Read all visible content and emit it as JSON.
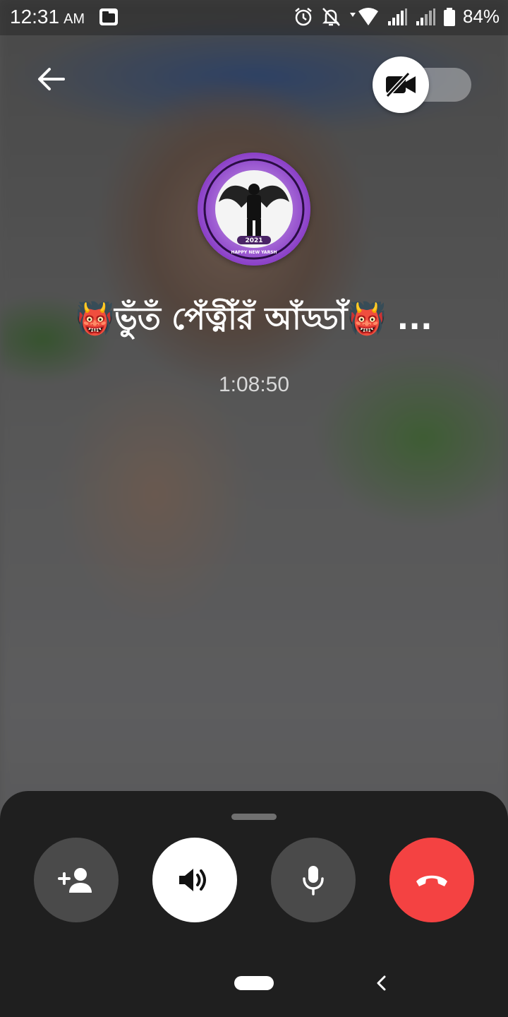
{
  "status_bar": {
    "time": "12:31",
    "ampm": "AM",
    "battery_percent": "84%",
    "icons": [
      "folder-icon",
      "alarm-icon",
      "notifications-off-icon",
      "wifi-icon",
      "signal-icon",
      "signal-icon-2",
      "battery-icon"
    ]
  },
  "call": {
    "name": "👹ভুঁতঁ পেঁত্নীঁরঁ আঁড্ডাঁ👹 ...",
    "duration": "1:08:50"
  },
  "avatar": {
    "badge_text": "2021",
    "footer_text": "HAPPY NEW YARSH"
  },
  "controls": {
    "add_person": "add-person-icon",
    "speaker": "speaker-icon",
    "mic": "mic-icon",
    "end_call": "end-call-icon",
    "video_toggle": "video-off-icon"
  },
  "colors": {
    "end_call": "#f44242",
    "sheet_bg": "#1f1f1f",
    "control_gray": "#4a4a4a",
    "avatar_purple": "#9b59d0"
  }
}
